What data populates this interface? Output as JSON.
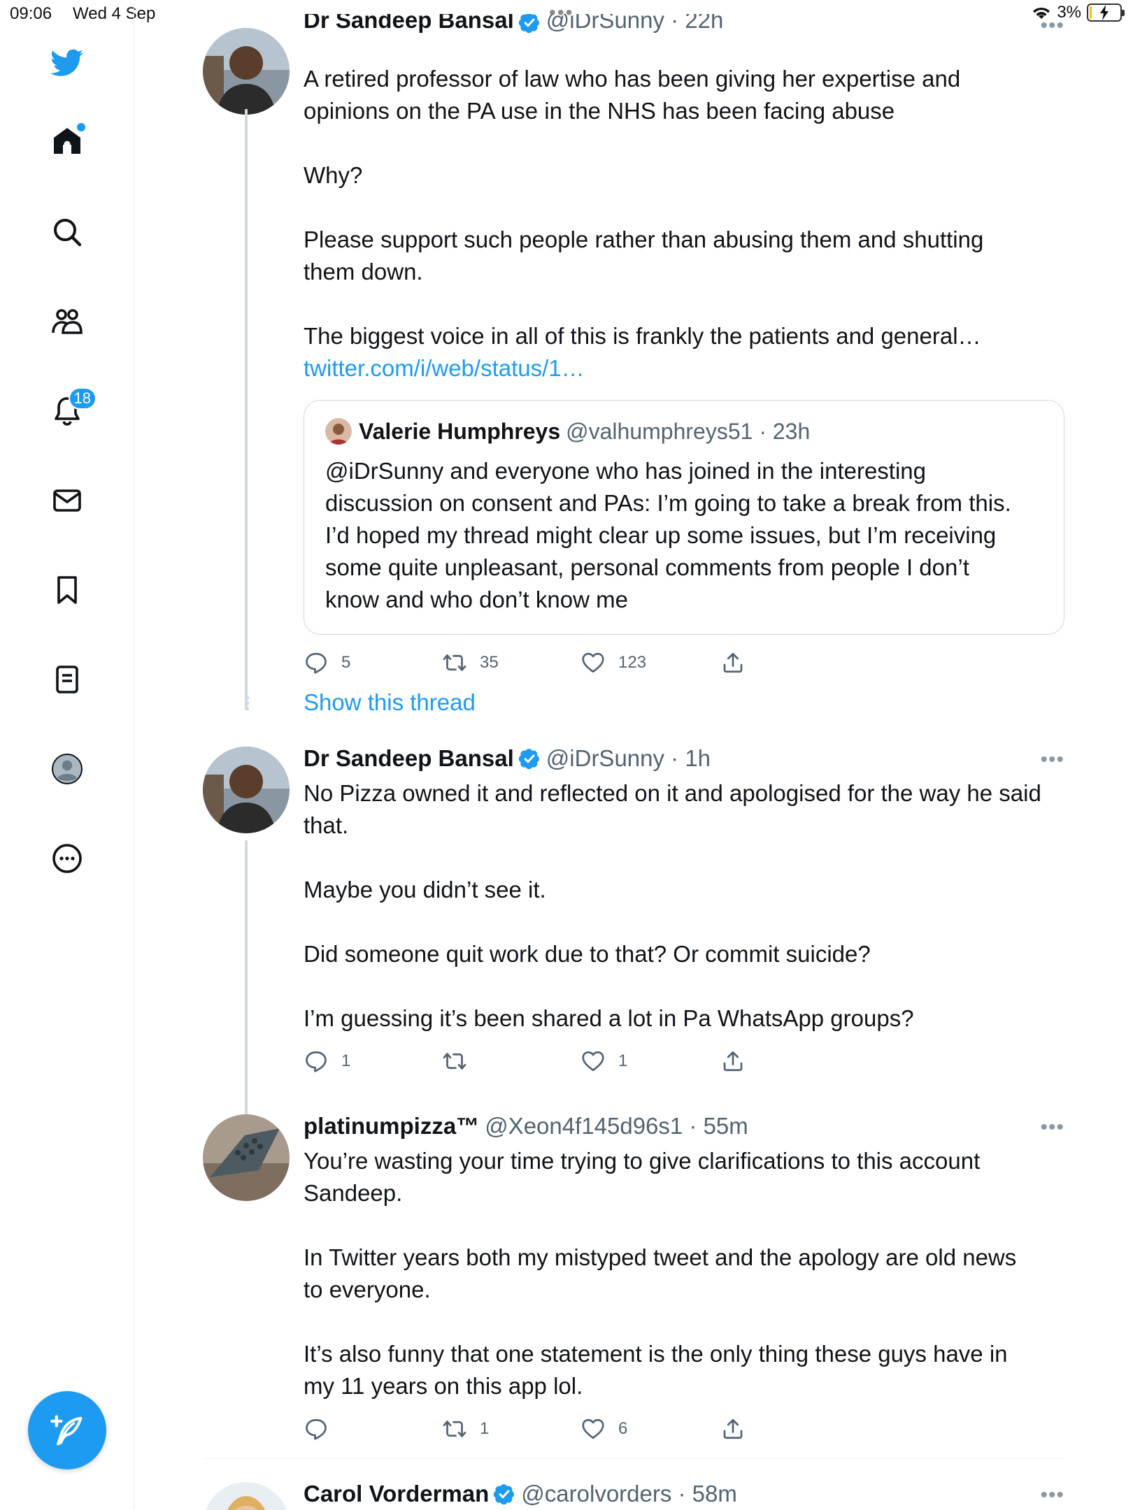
{
  "status_bar": {
    "time": "09:06",
    "date": "Wed 4 Sep",
    "battery": "3%",
    "battery_level": 0.03
  },
  "sidebar": {
    "notification_count": "18",
    "items": [
      "twitter-logo",
      "home-icon",
      "search-icon",
      "communities-icon",
      "notifications-icon",
      "messages-icon",
      "bookmarks-icon",
      "lists-icon",
      "profile-icon",
      "more-icon"
    ]
  },
  "colors": {
    "accent": "#1d9bf0",
    "text": "#0f1419",
    "secondary": "#536471",
    "line": "#cfd9de"
  },
  "tweets": [
    {
      "name": "Dr Sandeep Bansal",
      "handle": "@iDrSunny · 22h",
      "text": "A retired professor of law who has been giving her expertise and\nopinions on the PA use in the NHS has been facing abuse\n\nWhy?\n\nPlease support such people rather than abusing them and shutting\nthem down.\n\nThe biggest voice in all of this is frankly the patients and general…",
      "link": "twitter.com/i/web/status/1…",
      "quote": {
        "name": "Valerie Humphreys",
        "handle": "@valhumphreys51 · 23h",
        "text": "@iDrSunny and everyone who has joined in the interesting\ndiscussion on consent and PAs: I’m going to take a break from this.\nI’d hoped my thread might clear up some issues, but I’m receiving\nsome quite unpleasant, personal comments from people I don’t\nknow and who don’t know me"
      },
      "replies": "5",
      "retweets": "35",
      "likes": "123"
    },
    {
      "show_thread": "Show this thread"
    },
    {
      "name": "Dr Sandeep Bansal",
      "handle": "@iDrSunny · 1h",
      "text": "No Pizza owned it and reflected on it and apologised for the way he said\nthat.\n\nMaybe you didn’t see it.\n\nDid someone quit work due to that? Or commit suicide?\n\nI’m guessing it’s been shared a lot in Pa WhatsApp groups?",
      "replies": "1",
      "retweets": "",
      "likes": "1"
    },
    {
      "name": "platinumpizza™",
      "handle": "@Xeon4f145d96s1 · 55m",
      "text": "You’re wasting your time trying to give clarifications to this account\nSandeep.\n\nIn Twitter years both my mistyped tweet and the apology are old news\nto everyone.\n\nIt’s also funny that one statement is the only thing these guys have in\nmy 11 years on this app lol.",
      "replies": "",
      "retweets": "1",
      "likes": "6"
    },
    {
      "name": "Carol Vorderman",
      "handle": "@carolvorders · 58m"
    }
  ]
}
